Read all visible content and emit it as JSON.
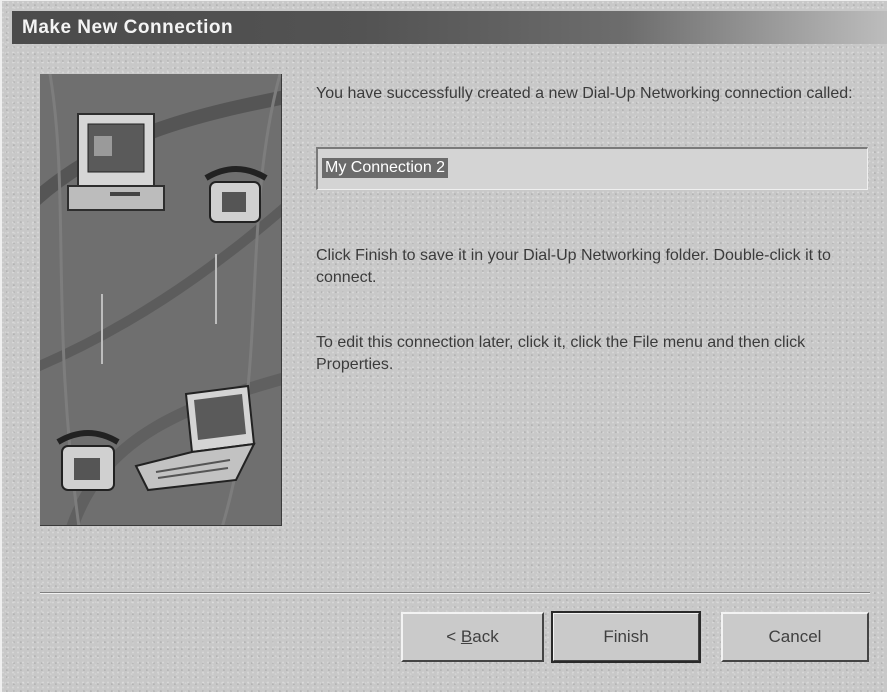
{
  "window": {
    "title": "Make New Connection"
  },
  "content": {
    "success_message": "You have successfully created a new Dial-Up Networking connection called:",
    "connection_name": "My Connection 2",
    "instruction_finish": "Click Finish to save it in your Dial-Up Networking folder. Double-click it to connect.",
    "instruction_edit": "To edit this connection later, click it, click the File menu and then click Properties."
  },
  "buttons": {
    "back_prefix": "< ",
    "back_mnemonic": "B",
    "back_rest": "ack",
    "finish": "Finish",
    "cancel": "Cancel"
  },
  "illustration": {
    "icons": [
      "desktop-computer-icon",
      "telephone-icon",
      "laptop-computer-icon",
      "telephone-icon"
    ]
  }
}
